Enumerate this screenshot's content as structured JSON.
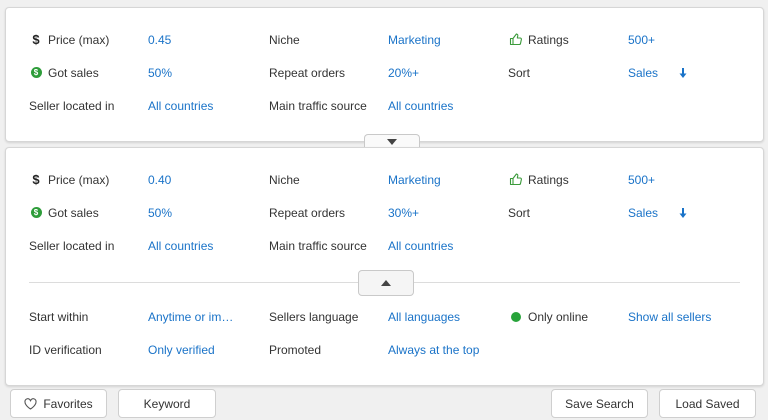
{
  "panel1": {
    "price_label": "Price (max)",
    "price_value": "0.45",
    "niche_label": "Niche",
    "niche_value": "Marketing",
    "ratings_label": "Ratings",
    "ratings_value": "500+",
    "sales_label": "Got sales",
    "sales_value": "50%",
    "repeat_label": "Repeat orders",
    "repeat_value": "20%+",
    "sort_label": "Sort",
    "sort_value": "Sales",
    "location_label": "Seller located in",
    "location_value": "All countries",
    "traffic_label": "Main traffic source",
    "traffic_value": "All countries"
  },
  "panel2": {
    "price_label": "Price (max)",
    "price_value": "0.40",
    "niche_label": "Niche",
    "niche_value": "Marketing",
    "ratings_label": "Ratings",
    "ratings_value": "500+",
    "sales_label": "Got sales",
    "sales_value": "50%",
    "repeat_label": "Repeat orders",
    "repeat_value": "30%+",
    "sort_label": "Sort",
    "sort_value": "Sales",
    "location_label": "Seller located in",
    "location_value": "All countries",
    "traffic_label": "Main traffic source",
    "traffic_value": "All countries",
    "start_label": "Start within",
    "start_value": "Anytime or imm…",
    "lang_label": "Sellers language",
    "lang_value": "All languages",
    "online_label": "Only online",
    "show_all": "Show all sellers",
    "id_label": "ID verification",
    "id_value": "Only verified",
    "promoted_label": "Promoted",
    "promoted_value": "Always at the top"
  },
  "buttons": {
    "favorites": "Favorites",
    "keyword": "Keyword",
    "save_search": "Save Search",
    "load_saved": "Load Saved"
  },
  "icons": {
    "price": "dollar-icon",
    "sales": "money-coin-icon",
    "ratings": "thumbs-up-icon",
    "sort": "arrow-down-icon",
    "online": "online-dot-icon",
    "favorites": "heart-icon",
    "collapse": "triangle-up-icon",
    "expand": "triangle-down-icon"
  },
  "colors": {
    "link": "#1a73c8",
    "online": "#27a33a",
    "coin": "#2e9d3a",
    "thumb": "#3a9a3a"
  }
}
